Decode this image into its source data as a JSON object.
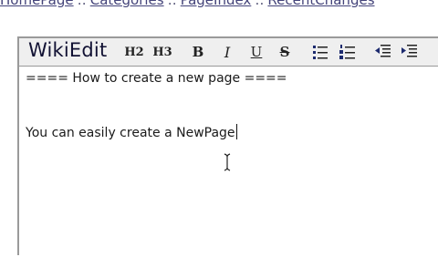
{
  "nav": {
    "links": [
      "HomePage",
      "Categories",
      "PageIndex",
      "RecentChanges"
    ],
    "separator": "::"
  },
  "editor": {
    "brand": "WikiEdit",
    "toolbar": {
      "h2": "H2",
      "h3": "H3",
      "bold": "B",
      "italic": "I",
      "underline": "U",
      "strike": "S",
      "icons": [
        "unordered-list-icon",
        "ordered-list-icon",
        "outdent-icon",
        "indent-icon"
      ]
    },
    "content": {
      "line1": "==== How to create a new page ====",
      "line2": "You can easily create a NewPage"
    }
  }
}
